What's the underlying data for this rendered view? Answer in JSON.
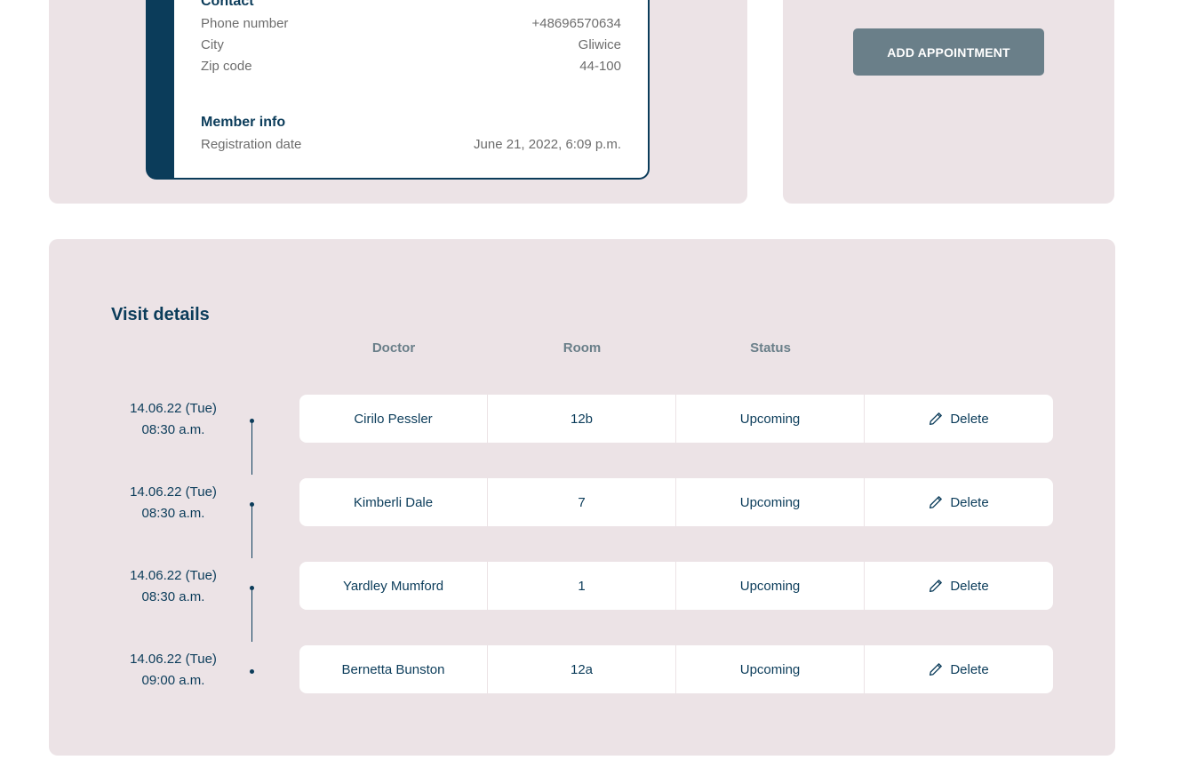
{
  "profile": {
    "contact": {
      "title": "Contact",
      "rows": [
        {
          "label": "Phone number",
          "value": "+48696570634"
        },
        {
          "label": "City",
          "value": "Gliwice"
        },
        {
          "label": "Zip code",
          "value": "44-100"
        }
      ]
    },
    "member": {
      "title": "Member info",
      "rows": [
        {
          "label": "Registration date",
          "value": "June 21, 2022, 6:09 p.m."
        }
      ]
    }
  },
  "actions": {
    "add_appointment_label": "ADD APPOINTMENT"
  },
  "visits": {
    "title": "Visit details",
    "columns": [
      "Doctor",
      "Room",
      "Status"
    ],
    "delete_label": "Delete",
    "rows": [
      {
        "date": "14.06.22 (Tue)",
        "time": "08:30 a.m.",
        "doctor": "Cirilo Pessler",
        "room": "12b",
        "status": "Upcoming"
      },
      {
        "date": "14.06.22 (Tue)",
        "time": "08:30 a.m.",
        "doctor": "Kimberli Dale",
        "room": "7",
        "status": "Upcoming"
      },
      {
        "date": "14.06.22 (Tue)",
        "time": "08:30 a.m.",
        "doctor": "Yardley Mumford",
        "room": "1",
        "status": "Upcoming"
      },
      {
        "date": "14.06.22 (Tue)",
        "time": "09:00 a.m.",
        "doctor": "Bernetta Bunston",
        "room": "12a",
        "status": "Upcoming"
      }
    ]
  },
  "colors": {
    "primary": "#0b3c5a",
    "panel_bg": "#ece3e6",
    "button_bg": "#6a7f89",
    "muted_text": "#6d6d6d"
  },
  "icons": {
    "delete": "pencil-icon"
  }
}
